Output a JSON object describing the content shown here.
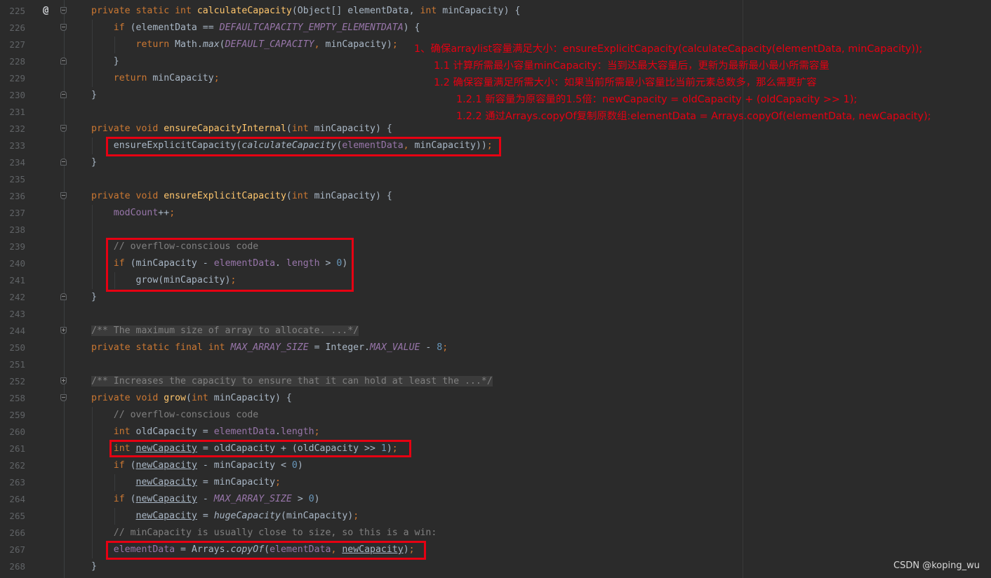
{
  "editor": {
    "lines": [
      {
        "n": "225",
        "spans": [
          [
            "kw",
            "private static int "
          ],
          [
            "fn",
            "calculateCapacity"
          ],
          [
            "",
            "(Object[] elementData, "
          ],
          [
            "kw",
            "int "
          ],
          [
            "",
            "minCapacity) {"
          ]
        ]
      },
      {
        "n": "226",
        "spans": [
          [
            "",
            "    "
          ],
          [
            "kw",
            "if "
          ],
          [
            "",
            "(elementData == "
          ],
          [
            "cst",
            "DEFAULTCAPACITY_EMPTY_ELEMENTDATA"
          ],
          [
            "",
            ") {"
          ]
        ]
      },
      {
        "n": "227",
        "spans": [
          [
            "",
            "        "
          ],
          [
            "kw",
            "return "
          ],
          [
            "",
            "Math."
          ],
          [
            "ital",
            "max"
          ],
          [
            "",
            "("
          ],
          [
            "cst",
            "DEFAULT_CAPACITY"
          ],
          [
            "kw",
            ", "
          ],
          [
            "",
            "minCapacity)"
          ],
          [
            "kw",
            ";"
          ]
        ]
      },
      {
        "n": "228",
        "spans": [
          [
            "",
            "    }"
          ]
        ]
      },
      {
        "n": "229",
        "spans": [
          [
            "",
            "    "
          ],
          [
            "kw",
            "return "
          ],
          [
            "",
            "minCapacity"
          ],
          [
            "kw",
            ";"
          ]
        ]
      },
      {
        "n": "230",
        "spans": [
          [
            "",
            "}"
          ]
        ]
      },
      {
        "n": "231",
        "spans": []
      },
      {
        "n": "232",
        "spans": [
          [
            "kw",
            "private void "
          ],
          [
            "fn",
            "ensureCapacityInternal"
          ],
          [
            "",
            "("
          ],
          [
            "kw",
            "int "
          ],
          [
            "",
            "minCapacity) {"
          ]
        ]
      },
      {
        "n": "233",
        "spans": [
          [
            "",
            "    ensureExplicitCapacity("
          ],
          [
            "ital",
            "calculateCapacity"
          ],
          [
            "",
            "("
          ],
          [
            "fld",
            "elementData"
          ],
          [
            "kw",
            ", "
          ],
          [
            "",
            "minCapacity))"
          ],
          [
            "kw",
            ";"
          ]
        ]
      },
      {
        "n": "234",
        "spans": [
          [
            "",
            "}"
          ]
        ]
      },
      {
        "n": "235",
        "spans": []
      },
      {
        "n": "236",
        "spans": [
          [
            "kw",
            "private void "
          ],
          [
            "fn",
            "ensureExplicitCapacity"
          ],
          [
            "",
            "("
          ],
          [
            "kw",
            "int "
          ],
          [
            "",
            "minCapacity) {"
          ]
        ]
      },
      {
        "n": "237",
        "spans": [
          [
            "",
            "    "
          ],
          [
            "fld",
            "modCount"
          ],
          [
            "",
            "++"
          ],
          [
            "kw",
            ";"
          ]
        ]
      },
      {
        "n": "238",
        "spans": []
      },
      {
        "n": "239",
        "spans": [
          [
            "",
            "    "
          ],
          [
            "cmt",
            "// overflow-conscious code"
          ]
        ]
      },
      {
        "n": "240",
        "spans": [
          [
            "",
            "    "
          ],
          [
            "kw",
            "if "
          ],
          [
            "",
            "(minCapacity - "
          ],
          [
            "fld",
            "elementData"
          ],
          [
            "",
            ". "
          ],
          [
            "fld",
            "length"
          ],
          [
            "",
            " > "
          ],
          [
            "num",
            "0"
          ],
          [
            "",
            ")"
          ]
        ]
      },
      {
        "n": "241",
        "spans": [
          [
            "",
            "        grow(minCapacity)"
          ],
          [
            "kw",
            ";"
          ]
        ]
      },
      {
        "n": "242",
        "spans": [
          [
            "",
            "}"
          ]
        ]
      },
      {
        "n": "243",
        "spans": []
      },
      {
        "n": "244",
        "spans": [
          [
            "folded",
            "/** The maximum size of array to allocate. ...*/"
          ]
        ]
      },
      {
        "n": "250",
        "spans": [
          [
            "kw",
            "private static final int "
          ],
          [
            "cst",
            "MAX_ARRAY_SIZE"
          ],
          [
            "",
            " = Integer."
          ],
          [
            "cst",
            "MAX_VALUE"
          ],
          [
            "",
            " - "
          ],
          [
            "num",
            "8"
          ],
          [
            "kw",
            ";"
          ]
        ]
      },
      {
        "n": "251",
        "spans": []
      },
      {
        "n": "252",
        "spans": [
          [
            "folded",
            "/** Increases the capacity to ensure that it can hold at least the ...*/"
          ]
        ]
      },
      {
        "n": "258",
        "spans": [
          [
            "kw",
            "private void "
          ],
          [
            "fn",
            "grow"
          ],
          [
            "",
            "("
          ],
          [
            "kw",
            "int "
          ],
          [
            "",
            "minCapacity) {"
          ]
        ]
      },
      {
        "n": "259",
        "spans": [
          [
            "",
            "    "
          ],
          [
            "cmt",
            "// overflow-conscious code"
          ]
        ]
      },
      {
        "n": "260",
        "spans": [
          [
            "",
            "    "
          ],
          [
            "kw",
            "int "
          ],
          [
            "",
            "oldCapacity = "
          ],
          [
            "fld",
            "elementData"
          ],
          [
            "",
            "."
          ],
          [
            "fld",
            "length"
          ],
          [
            "kw",
            ";"
          ]
        ]
      },
      {
        "n": "261",
        "spans": [
          [
            "",
            "    "
          ],
          [
            "kw",
            "int "
          ],
          [
            "ul",
            "newCapacity"
          ],
          [
            "",
            " = oldCapacity + (oldCapacity >> "
          ],
          [
            "num",
            "1"
          ],
          [
            "",
            ")"
          ],
          [
            "kw",
            ";"
          ]
        ]
      },
      {
        "n": "262",
        "spans": [
          [
            "",
            "    "
          ],
          [
            "kw",
            "if "
          ],
          [
            "",
            "("
          ],
          [
            "ul",
            "newCapacity"
          ],
          [
            "",
            " - minCapacity < "
          ],
          [
            "num",
            "0"
          ],
          [
            "",
            ")"
          ]
        ]
      },
      {
        "n": "263",
        "spans": [
          [
            "",
            "        "
          ],
          [
            "ul",
            "newCapacity"
          ],
          [
            "",
            " = minCapacity"
          ],
          [
            "kw",
            ";"
          ]
        ]
      },
      {
        "n": "264",
        "spans": [
          [
            "",
            "    "
          ],
          [
            "kw",
            "if "
          ],
          [
            "",
            "("
          ],
          [
            "ul",
            "newCapacity"
          ],
          [
            "",
            " - "
          ],
          [
            "cst",
            "MAX_ARRAY_SIZE"
          ],
          [
            "",
            " > "
          ],
          [
            "num",
            "0"
          ],
          [
            "",
            ")"
          ]
        ]
      },
      {
        "n": "265",
        "spans": [
          [
            "",
            "        "
          ],
          [
            "ul",
            "newCapacity"
          ],
          [
            "",
            " = "
          ],
          [
            "ital",
            "hugeCapacity"
          ],
          [
            "",
            "(minCapacity)"
          ],
          [
            "kw",
            ";"
          ]
        ]
      },
      {
        "n": "266",
        "spans": [
          [
            "",
            "    "
          ],
          [
            "cmt",
            "// minCapacity is usually close to size, so this is a win:"
          ]
        ]
      },
      {
        "n": "267",
        "spans": [
          [
            "",
            "    "
          ],
          [
            "fld",
            "elementData"
          ],
          [
            "",
            " = Arrays."
          ],
          [
            "ital",
            "copyOf"
          ],
          [
            "",
            "("
          ],
          [
            "fld",
            "elementData"
          ],
          [
            "kw",
            ", "
          ],
          [
            "ul",
            "newCapacity"
          ],
          [
            "",
            ")"
          ],
          [
            "kw",
            ";"
          ]
        ]
      },
      {
        "n": "268",
        "spans": [
          [
            "",
            "}"
          ]
        ]
      }
    ],
    "override_icon": "@"
  },
  "annotations": {
    "note_1": "1、确保arraylist容量满足大小：ensureExplicitCapacity(calculateCapacity(elementData, minCapacity));",
    "note_1_1": "1.1 计算所需最小容量minCapacity：当到达最大容量后，更新为最新最小最小所需容量",
    "note_1_2": "1.2 确保容量满足所需大小：如果当前所需最小容量比当前元素总数多，那么需要扩容",
    "note_1_2_1": "1.2.1 新容量为原容量的1.5倍：newCapacity = oldCapacity + (oldCapacity >> 1);",
    "note_1_2_2": "1.2.2 通过Arrays.copyOf复制原数组:elementData = Arrays.copyOf(elementData, newCapacity);"
  },
  "watermark": "CSDN @koping_wu",
  "colors": {
    "background": "#2b2b2b",
    "keyword": "#cc7832",
    "function": "#ffc66d",
    "field": "#9876aa",
    "number": "#6897bb",
    "comment": "#808080",
    "text": "#a9b7c6",
    "highlight": "#e60012"
  }
}
